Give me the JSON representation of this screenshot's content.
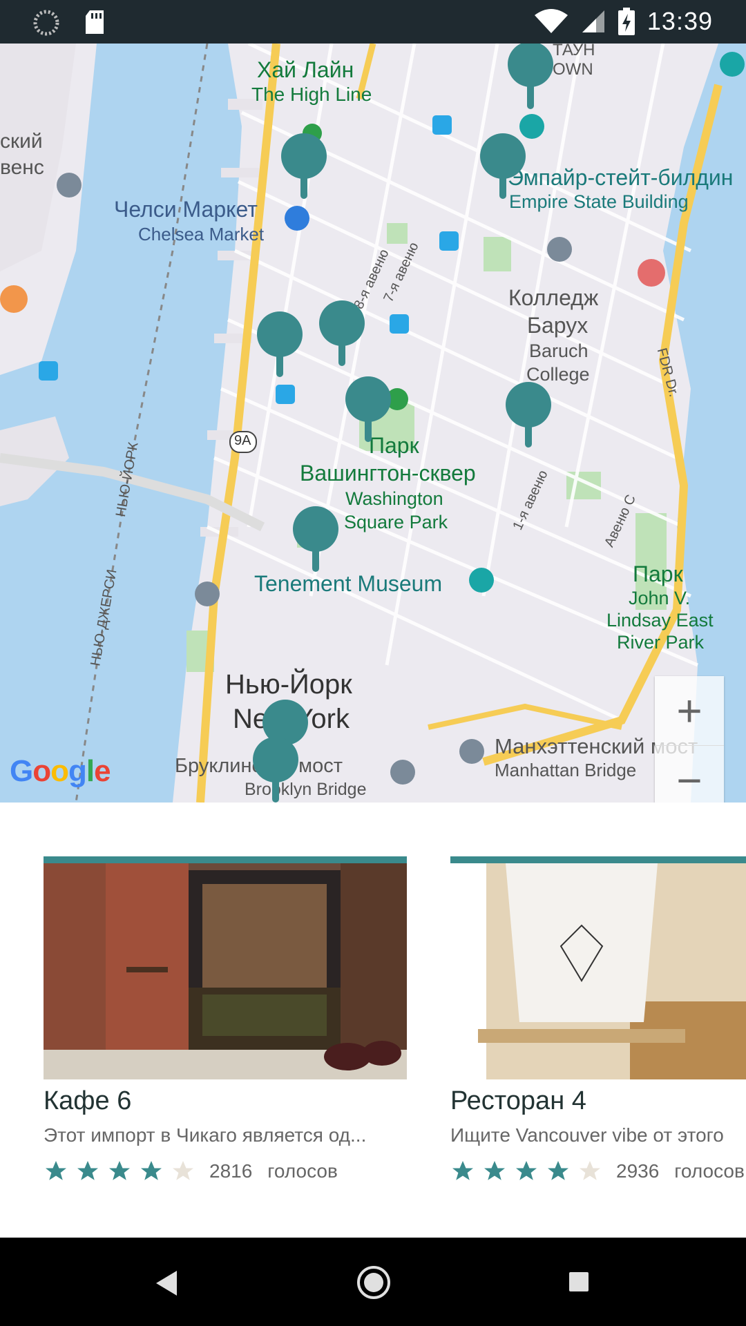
{
  "status_bar": {
    "time": "13:39",
    "icons": [
      "sync-icon",
      "sd-card-icon",
      "wifi-icon",
      "signal-icon",
      "battery-charging-icon"
    ]
  },
  "map": {
    "labels": {
      "high_line_ru": "Хай Лайн",
      "high_line_en": "The High Line",
      "chelsea_ru": "Челси Маркет",
      "chelsea_en": "Chelsea Market",
      "empire_ru": "Эмпайр-стейт-билдин",
      "empire_en": "Empire State Building",
      "baruch_ru_1": "Колледж",
      "baruch_ru_2": "Барух",
      "baruch_en_1": "Baruch",
      "baruch_en_2": "College",
      "wsp_ru_1": "Парк",
      "wsp_ru_2": "Вашингтон-сквер",
      "wsp_en_1": "Washington",
      "wsp_en_2": "Square Park",
      "tenement": "Tenement Museum",
      "lindsay_ru": "Парк",
      "lindsay_en_1": "John V.",
      "lindsay_en_2": "Lindsay East",
      "lindsay_en_3": "River Park",
      "ny_ru": "Нью-Йорк",
      "ny_en": "New York",
      "brooklyn_ru": "Бруклинский мост",
      "brooklyn_en": "Brooklyn Bridge",
      "manhattan_ru": "Манхэттенский мост",
      "manhattan_en": "Manhattan Bridge",
      "left_ru_1": "ский",
      "left_ru_2": "венс",
      "town_1": "ТАУН",
      "town_2": "OWN",
      "ave8": "8-я авеню",
      "ave7": "7-я авеню",
      "ave1": "1-я авеню",
      "avec": "Авеню C",
      "fdr": "FDR Dr.",
      "ny_nj_1": "НЬЮ-ЙОРК",
      "ny_nj_2": "НЬЮ-ДЖЕРСИ",
      "route": "9A"
    },
    "google_logo": "Google",
    "zoom_in": "+",
    "zoom_out": "−",
    "pin_color": "#3a8a8c"
  },
  "cards": [
    {
      "title": "Кафе 6",
      "description": "Этот импорт в Чикаго является од...",
      "rating": 4,
      "max_rating": 5,
      "votes": "2816",
      "votes_label": "голосов"
    },
    {
      "title": "Ресторан 4",
      "description": "Ищите Vancouver vibe от этого",
      "rating": 4,
      "max_rating": 5,
      "votes": "2936",
      "votes_label": "голосов"
    }
  ],
  "nav": {
    "icons": [
      "back-icon",
      "home-icon",
      "recents-icon"
    ]
  }
}
